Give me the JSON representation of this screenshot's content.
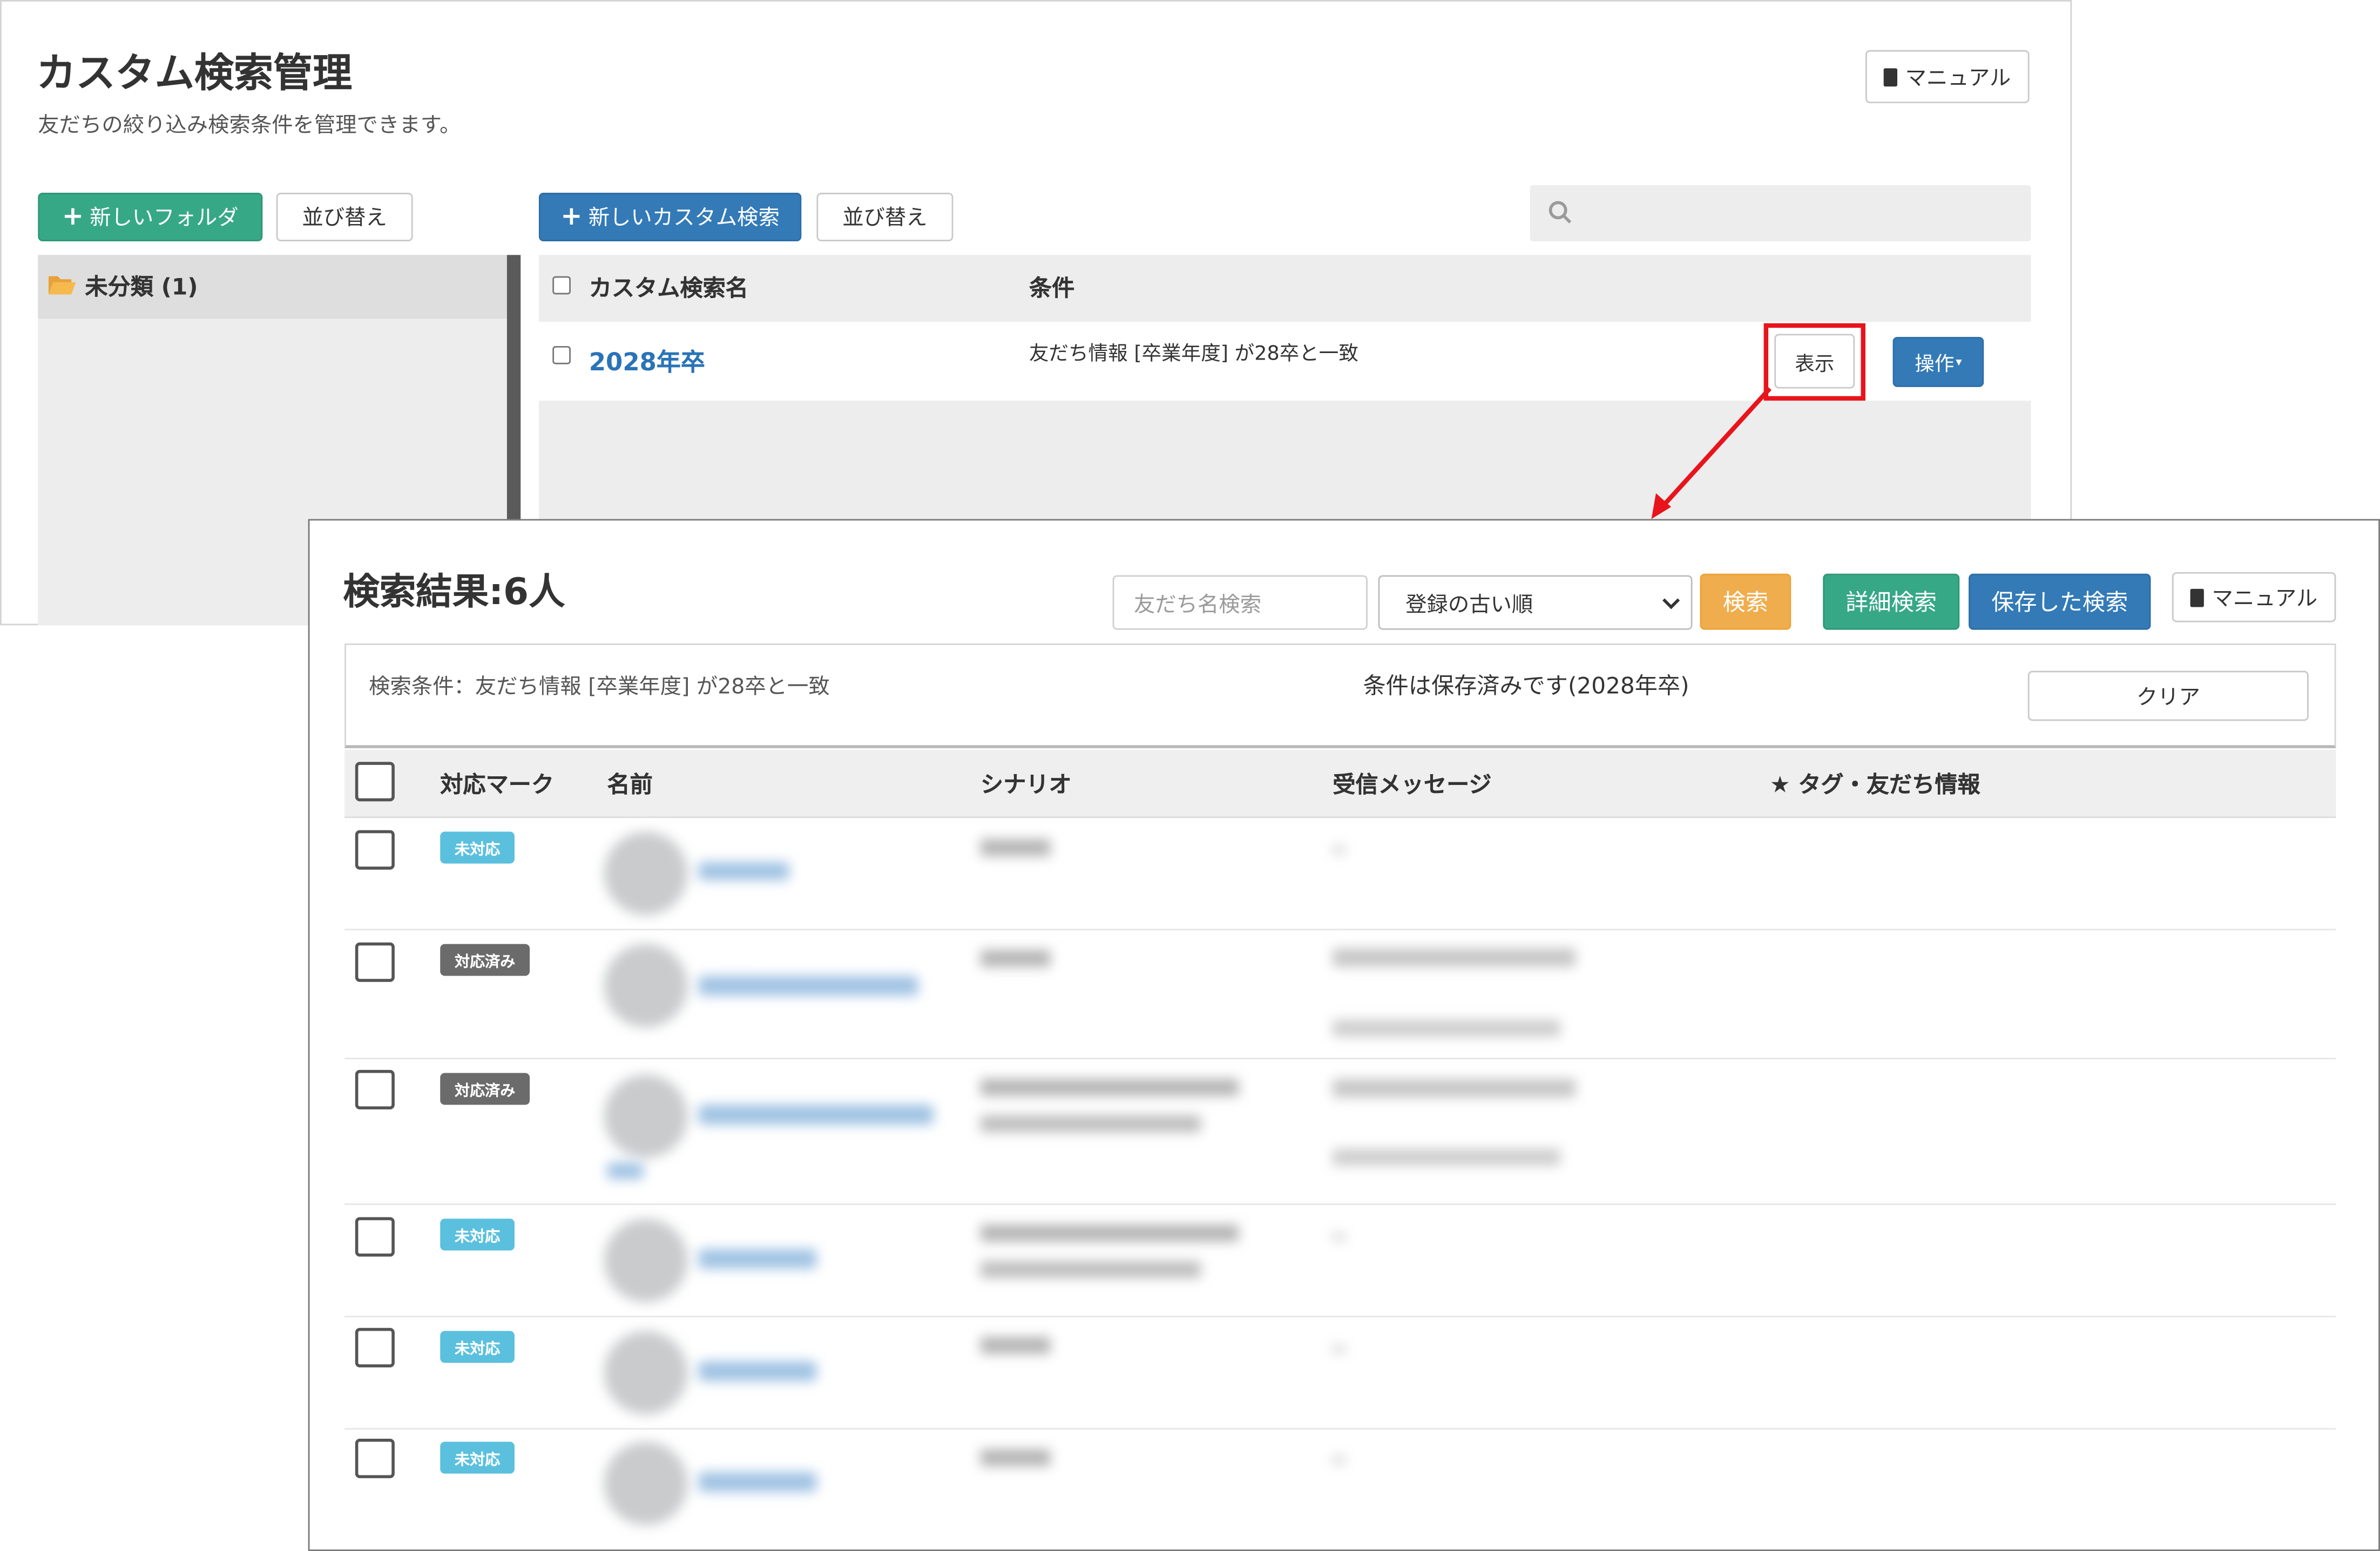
{
  "custom_search": {
    "title": "カスタム検索管理",
    "subtitle": "友だちの絞り込み検索条件を管理できます。",
    "manual_label": "マニュアル",
    "new_folder_label": "新しいフォルダ",
    "sort_label_left": "並び替え",
    "new_custom_search_label": "新しいカスタム検索",
    "sort_label_right": "並び替え",
    "search_placeholder": "",
    "folder": "未分類 (1)",
    "col_name": "カスタム検索名",
    "col_condition": "条件",
    "row": {
      "name": "2028年卒",
      "condition": "友だち情報 [卒業年度] が28卒と一致",
      "view_label": "表示",
      "ops_label": "操作"
    }
  },
  "results": {
    "title": "検索結果:6人",
    "name_search_placeholder": "友だち名検索",
    "sort_selected": "登録の古い順",
    "search_label": "検索",
    "detail_search_label": "詳細検索",
    "saved_search_label": "保存した検索",
    "manual_label": "マニュアル",
    "condition_text": "検索条件：友だち情報 [卒業年度] が28卒と一致",
    "saved_status": "条件は保存済みです(2028年卒)",
    "clear_label": "クリア",
    "headers": {
      "mark": "対応マーク",
      "name": "名前",
      "scenario": "シナリオ",
      "message": "受信メッセージ",
      "tag": "★ タグ・友だち情報"
    },
    "rows": [
      {
        "badge": "未対応"
      },
      {
        "badge": "対応済み"
      },
      {
        "badge": "対応済み"
      },
      {
        "badge": "未対応"
      },
      {
        "badge": "未対応"
      },
      {
        "badge": "未対応"
      }
    ]
  },
  "colors": {
    "green": "#36a886",
    "blue": "#337ab7",
    "orange": "#f0ad4e",
    "badge_unhandled": "#5bc0de",
    "badge_handled": "#6b6b6b",
    "highlight": "#e8141c"
  }
}
